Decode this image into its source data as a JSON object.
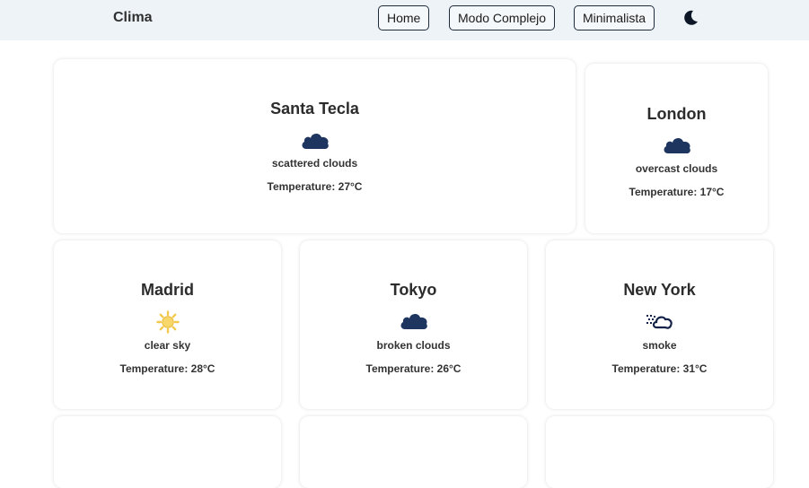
{
  "header": {
    "brand": "Clima",
    "nav": [
      "Home",
      "Modo Complejo",
      "Minimalista"
    ],
    "theme_icon": "moon-icon"
  },
  "temp_label": "Temperature:",
  "cards": [
    {
      "city": "Santa Tecla",
      "icon": "cloud-icon",
      "description": "scattered clouds",
      "temperature": "27°C"
    },
    {
      "city": "London",
      "icon": "cloud-icon",
      "description": "overcast clouds",
      "temperature": "17°C"
    },
    {
      "city": "Madrid",
      "icon": "sun-icon",
      "description": "clear sky",
      "temperature": "28°C"
    },
    {
      "city": "Tokyo",
      "icon": "cloud-icon",
      "description": "broken clouds",
      "temperature": "26°C"
    },
    {
      "city": "New York",
      "icon": "smoke-icon",
      "description": "smoke",
      "temperature": "31°C"
    }
  ],
  "colors": {
    "cloud": "#1e3560",
    "sun": "#f2c94c",
    "header_bg": "#eef3f8"
  }
}
